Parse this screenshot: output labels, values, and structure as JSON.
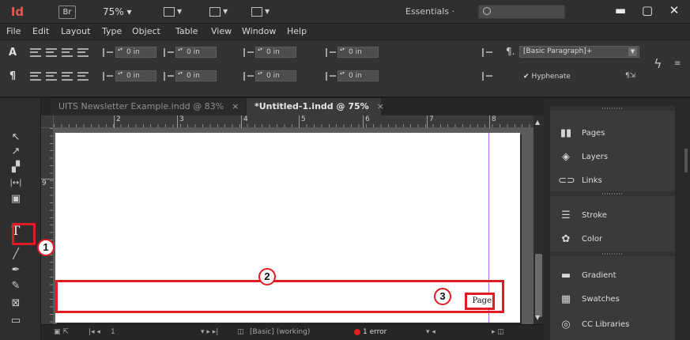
{
  "titlebar": {
    "logo": "Id",
    "bridge": "Br",
    "zoom": "75% ▾",
    "workspace": "Essentials ·",
    "help_search_placeholder": ""
  },
  "window_buttons": {
    "minimize": "▬",
    "maximize": "▢",
    "close": "✕"
  },
  "menu": {
    "file": "File",
    "edit": "Edit",
    "layout": "Layout",
    "type": "Type",
    "object": "Object",
    "table": "Table",
    "view": "View",
    "window": "Window",
    "help": "Help"
  },
  "control": {
    "mode_char": "A",
    "mode_para": "¶",
    "spin_values": [
      "0 in",
      "0 in",
      "0 in",
      "0 in",
      "0 in",
      "0 in",
      "0 in",
      "0 in"
    ],
    "paragraph_style": "[Basic Paragraph]+",
    "hyphenate_label": "Hyphenate",
    "hyphenate_checked": true
  },
  "tools": {
    "selection": "↖",
    "direct": "↗",
    "page": "▞",
    "gap": "|↔|",
    "content": "▣",
    "type": "T",
    "line": "╱",
    "pen": "✒",
    "pencil": "✎",
    "frame": "⊠",
    "rectangle": "▭"
  },
  "tabs": [
    {
      "label": "UITS Newsletter Example.indd @ 83%",
      "close": "×",
      "active": false
    },
    {
      "label": "*Untitled-1.indd @ 75%",
      "close": "×",
      "active": true
    }
  ],
  "ruler": {
    "h_ticks": [
      "2",
      "3",
      "4",
      "5",
      "6",
      "7",
      "8"
    ],
    "v_ticks": [
      "9"
    ]
  },
  "document": {
    "footer_text": "Page"
  },
  "status": {
    "page": "1",
    "preflight_profile": "[Basic] (working)",
    "errors": "1 error"
  },
  "panels": [
    {
      "icon": "pages-icon",
      "label": "Pages"
    },
    {
      "icon": "layers-icon",
      "label": "Layers"
    },
    {
      "icon": "links-icon",
      "label": "Links"
    },
    {
      "icon": "stroke-icon",
      "label": "Stroke"
    },
    {
      "icon": "color-icon",
      "label": "Color"
    },
    {
      "icon": "gradient-icon",
      "label": "Gradient"
    },
    {
      "icon": "swatches-icon",
      "label": "Swatches"
    },
    {
      "icon": "cc-libraries-icon",
      "label": "CC Libraries"
    }
  ],
  "callouts": [
    "1",
    "2",
    "3"
  ],
  "colors": {
    "highlight": "#e01b24",
    "accent_logo": "#e8584e",
    "guide": "#b86ee0"
  }
}
